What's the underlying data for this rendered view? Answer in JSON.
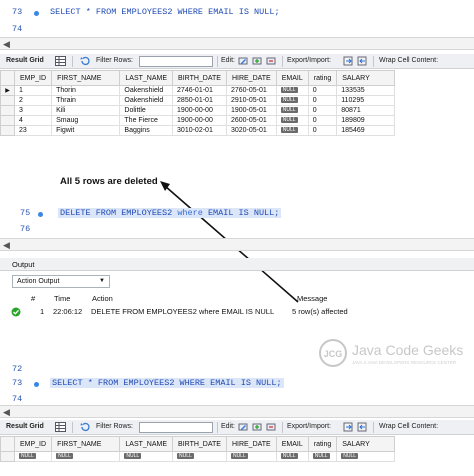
{
  "editor_top": {
    "lines": [
      {
        "num": "73",
        "code_parts": [
          "SELECT * FROM EMPLOYEES2 ",
          "WHERE",
          " EMAIL IS NULL;"
        ]
      },
      {
        "num": "74",
        "code_parts": []
      }
    ]
  },
  "result_toolbar": {
    "result_grid": "Result Grid",
    "filter_rows": "Filter Rows:",
    "edit": "Edit:",
    "export_import": "Export/Import:",
    "wrap_cell": "Wrap Cell Content:"
  },
  "grid1": {
    "columns": [
      "EMP_ID",
      "FIRST_NAME",
      "LAST_NAME",
      "BIRTH_DATE",
      "HIRE_DATE",
      "EMAIL",
      "rating",
      "SALARY"
    ],
    "rows": [
      [
        "1",
        "Thorin",
        "Oakenshield",
        "2746-01-01",
        "2760-05-01",
        "NULL",
        "0",
        "133535"
      ],
      [
        "2",
        "Thrain",
        "Oakenshield",
        "2850-01-01",
        "2910-05-01",
        "NULL",
        "0",
        "110295"
      ],
      [
        "3",
        "Kili",
        "Dolittle",
        "1900-00-00",
        "1900-05-01",
        "NULL",
        "0",
        "80871"
      ],
      [
        "4",
        "Smaug",
        "The Fierce",
        "1900-00-00",
        "2600-05-01",
        "NULL",
        "0",
        "189809"
      ],
      [
        "23",
        "Figwit",
        "Baggins",
        "3010-02-01",
        "3020-05-01",
        "NULL",
        "0",
        "185469"
      ]
    ]
  },
  "annotation": "All 5 rows are deleted",
  "editor_mid": {
    "lines": [
      {
        "num": "75",
        "code_parts": [
          "DELETE FROM EMPLOYEES2 ",
          "where",
          " EMAIL IS NULL;"
        ]
      },
      {
        "num": "76",
        "code_parts": []
      }
    ]
  },
  "output": {
    "title": "Output",
    "dropdown": "Action Output",
    "headers": {
      "num": "#",
      "time": "Time",
      "action": "Action",
      "message": "Message"
    },
    "row": {
      "num": "1",
      "time": "22:06:12",
      "action": "DELETE FROM EMPLOYEES2 where EMAIL IS NULL",
      "message": "5 row(s) affected"
    }
  },
  "editor_bottom": {
    "lines": [
      {
        "num": "72",
        "code_parts": []
      },
      {
        "num": "73",
        "code_parts": [
          "SELECT * FROM EMPLOYEES2 ",
          "WHERE",
          " EMAIL IS NULL;"
        ]
      },
      {
        "num": "74",
        "code_parts": []
      }
    ]
  },
  "grid2": {
    "columns": [
      "EMP_ID",
      "FIRST_NAME",
      "LAST_NAME",
      "BIRTH_DATE",
      "HIRE_DATE",
      "EMAIL",
      "rating",
      "SALARY"
    ],
    "rows": [
      [
        "NULL",
        "NULL",
        "NULL",
        "NULL",
        "NULL",
        "NULL",
        "NULL",
        "NULL"
      ]
    ]
  },
  "watermark": {
    "logo_text": "JCG",
    "brand": "Java Code Geeks",
    "tagline": "JAVA 2 JAVA DEVELOPERS RESOURCE CENTER"
  },
  "colors": {
    "sql_keyword": "#1f4ab5",
    "highlight": "#dbe6f8",
    "null_badge": "#6b6b6b",
    "success": "#2aa52a",
    "annotation_line": "#111111"
  }
}
